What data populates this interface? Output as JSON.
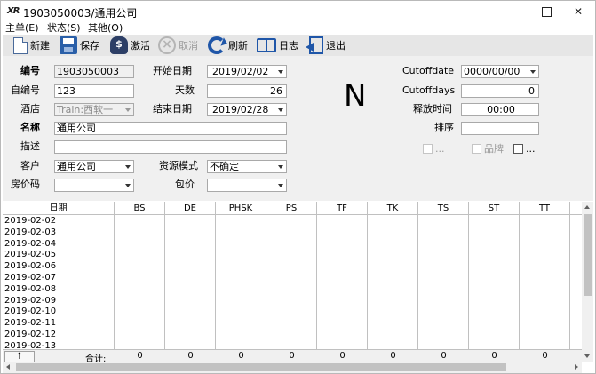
{
  "window": {
    "app_icon": "XR",
    "title": "1903050003/通用公司"
  },
  "menu": [
    "主单(E)",
    "状态(S)",
    "其他(O)"
  ],
  "toolbar": {
    "new": "新建",
    "save": "保存",
    "activate": "激活",
    "cancel": "取消",
    "refresh": "刷新",
    "log": "日志",
    "exit": "退出"
  },
  "form": {
    "code_label": "编号",
    "code_value": "1903050003",
    "self_code_label": "自编号",
    "self_code_value": "123",
    "hotel_label": "酒店",
    "hotel_value": "Train:西软一",
    "name_label": "名称",
    "name_value": "通用公司",
    "desc_label": "描述",
    "desc_value": "",
    "customer_label": "客户",
    "customer_value": "通用公司",
    "rate_code_label": "房价码",
    "rate_code_value": "",
    "start_date_label": "开始日期",
    "start_date_value": "2019/02/02",
    "days_label": "天数",
    "days_value": "26",
    "end_date_label": "结束日期",
    "end_date_value": "2019/02/28",
    "resource_mode_label": "资源模式",
    "resource_mode_value": "不确定",
    "package_label": "包价",
    "package_value": "",
    "status_letter": "N",
    "cutoffdate_label": "Cutoffdate",
    "cutoffdate_value": "0000/00/00",
    "cutoffdays_label": "Cutoffdays",
    "cutoffdays_value": "0",
    "release_time_label": "释放时间",
    "release_time_value": "00:00",
    "sort_label": "排序",
    "sort_value": "",
    "check1_label": "...",
    "check2_label": "品牌",
    "check3_label": "..."
  },
  "grid": {
    "columns": [
      "日期",
      "BS",
      "DE",
      "PHSK",
      "PS",
      "TF",
      "TK",
      "TS",
      "ST",
      "TT"
    ],
    "rows": [
      "2019-02-02",
      "2019-02-03",
      "2019-02-04",
      "2019-02-05",
      "2019-02-06",
      "2019-02-07",
      "2019-02-08",
      "2019-02-09",
      "2019-02-10",
      "2019-02-11",
      "2019-02-12",
      "2019-02-13"
    ],
    "sum_label": "合计:",
    "sums": [
      "0",
      "0",
      "0",
      "0",
      "0",
      "0",
      "0",
      "0",
      "0"
    ],
    "up_button": "↑"
  },
  "colors": {
    "toolbar_bg": "#e6e6e6",
    "panel_bg": "#f0f0f0",
    "icon_blue": "#1f56a8"
  }
}
